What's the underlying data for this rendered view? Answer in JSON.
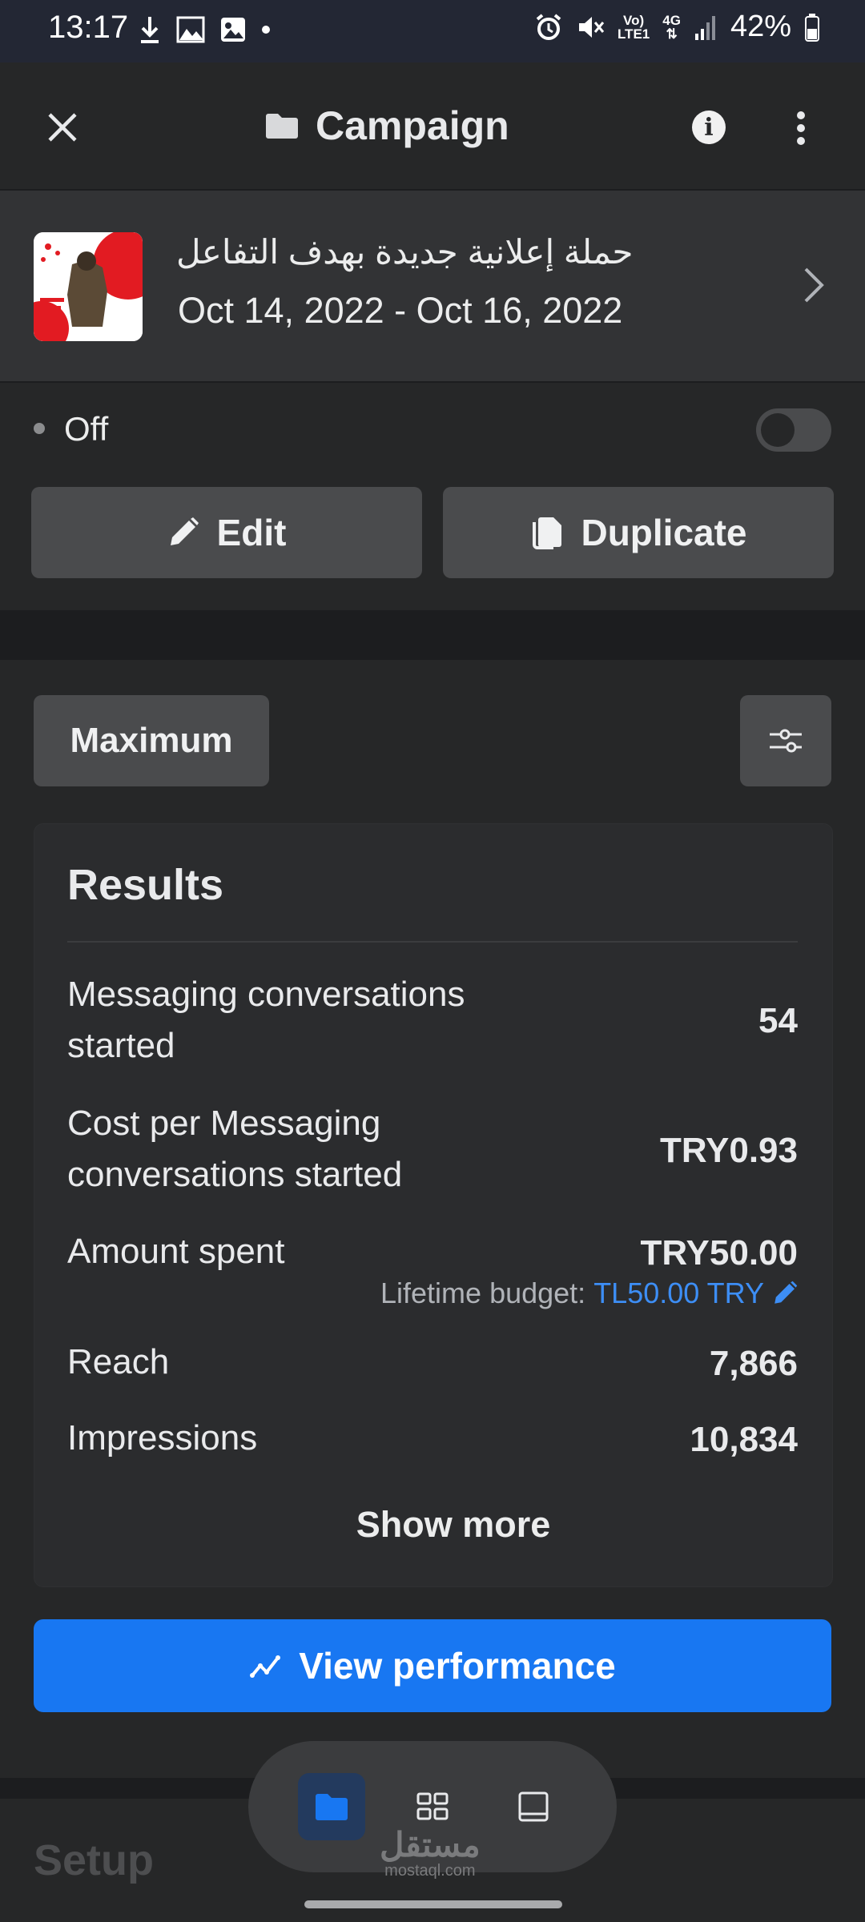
{
  "status_bar": {
    "time": "13:17",
    "network_top": "Vo)",
    "network_bottom": "LTE1",
    "data_top": "4G",
    "battery": "42%"
  },
  "header": {
    "title": "Campaign",
    "title_icon": "folder-icon",
    "close_icon": "close-icon",
    "info_icon": "info-icon",
    "more_icon": "more-vertical-icon"
  },
  "campaign": {
    "name": "حملة إعلانية جديدة بهدف التفاعل",
    "dates": "Oct 14, 2022 - Oct 16, 2022"
  },
  "status": {
    "label": "Off",
    "enabled": false
  },
  "actions": {
    "edit_label": "Edit",
    "duplicate_label": "Duplicate"
  },
  "date_range_button": "Maximum",
  "results": {
    "title": "Results",
    "metrics": [
      {
        "label_line1": "Messaging conversations",
        "label_line2": "started",
        "value": "54"
      },
      {
        "label_line1": "Cost per Messaging",
        "label_line2": "conversations started",
        "value": "TRY0.93"
      },
      {
        "label_line1": "Amount spent",
        "label_line2": "",
        "value": "TRY50.00"
      },
      {
        "label_line1": "Reach",
        "label_line2": "",
        "value": "7,866"
      },
      {
        "label_line1": "Impressions",
        "label_line2": "",
        "value": "10,834"
      }
    ],
    "budget_prefix": "Lifetime budget:",
    "budget_value": "TL50.00 TRY",
    "show_more": "Show more"
  },
  "view_performance": "View performance",
  "setup_title": "Setup",
  "watermark": {
    "arabic": "مستقل",
    "latin": "mostaql.com"
  },
  "colors": {
    "accent": "#1877f2",
    "link": "#3d8ef5",
    "background": "#262728"
  }
}
